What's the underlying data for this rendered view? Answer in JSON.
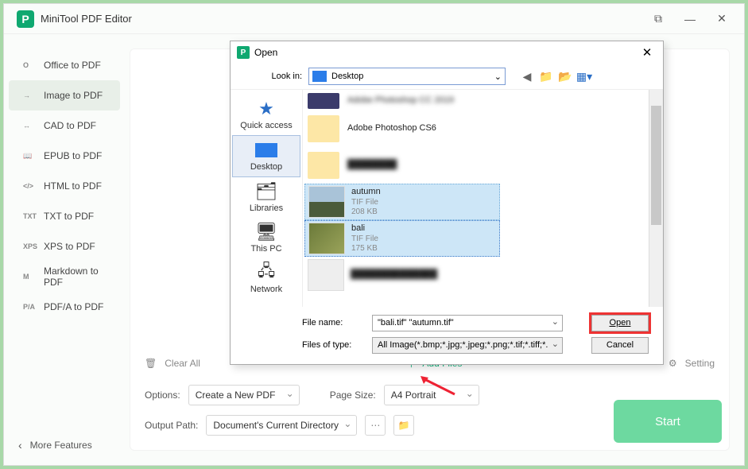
{
  "app": {
    "title": "MiniTool PDF Editor"
  },
  "sidebar": {
    "items": [
      {
        "icon": "O",
        "label": "Office to PDF"
      },
      {
        "icon": "→",
        "label": "Image to PDF"
      },
      {
        "icon": "↔",
        "label": "CAD to PDF"
      },
      {
        "icon": "📖",
        "label": "EPUB to PDF"
      },
      {
        "icon": "</>",
        "label": "HTML to PDF"
      },
      {
        "icon": "TXT",
        "label": "TXT to PDF"
      },
      {
        "icon": "XPS",
        "label": "XPS to PDF"
      },
      {
        "icon": "M",
        "label": "Markdown to PDF"
      },
      {
        "icon": "P/A",
        "label": "PDF/A to PDF"
      }
    ],
    "active_index": 1,
    "more": "More Features"
  },
  "toolbar": {
    "clear_all": "Clear All",
    "add_files": "Add Files",
    "setting": "Setting"
  },
  "options": {
    "options_label": "Options:",
    "options_value": "Create a New PDF",
    "pagesize_label": "Page Size:",
    "pagesize_value": "A4 Portrait",
    "output_label": "Output Path:",
    "output_value": "Document's Current Directory"
  },
  "start_label": "Start",
  "dialog": {
    "title": "Open",
    "lookin_label": "Look in:",
    "lookin_value": "Desktop",
    "places": [
      {
        "label": "Quick access"
      },
      {
        "label": "Desktop"
      },
      {
        "label": "Libraries"
      },
      {
        "label": "This PC"
      },
      {
        "label": "Network"
      }
    ],
    "places_selected_index": 1,
    "files": [
      {
        "name": "Adobe Photoshop CC 2019",
        "kind": "folder",
        "blur_name": false,
        "truncate": true
      },
      {
        "name": "Adobe Photoshop CS6",
        "kind": "folder"
      },
      {
        "name": "blurred",
        "kind": "folder",
        "blur_name": true
      },
      {
        "name": "autumn",
        "type": "TIF File",
        "size": "208 KB",
        "kind": "image",
        "selected": true
      },
      {
        "name": "bali",
        "type": "TIF File",
        "size": "175 KB",
        "kind": "image",
        "selected": true
      },
      {
        "name": "blurred2",
        "kind": "image",
        "blur_name": true
      }
    ],
    "filename_label": "File name:",
    "filename_value": "\"bali.tif\" \"autumn.tif\"",
    "filesoftype_label": "Files of type:",
    "filesoftype_value": "All Image(*.bmp;*.jpg;*.jpeg;*.png;*.tif;*.tiff;*.heic",
    "open_btn": "Open",
    "cancel_btn": "Cancel"
  }
}
